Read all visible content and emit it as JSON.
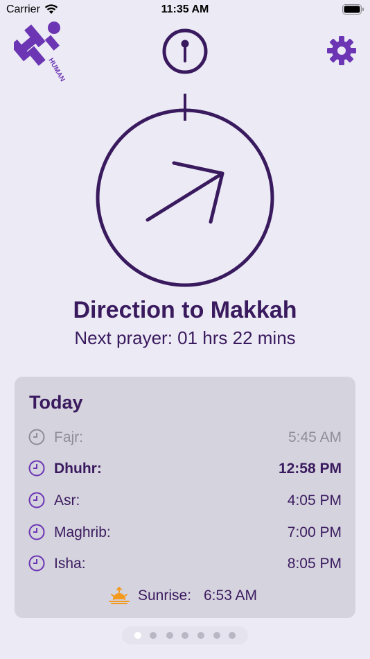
{
  "status_bar": {
    "carrier": "Carrier",
    "time": "11:35 AM"
  },
  "header": {
    "logo_text": "HUMAN APPEAL",
    "info_icon": "info-pin-icon",
    "settings_icon": "gear-icon"
  },
  "compass": {
    "title": "Direction to Makkah",
    "next_prayer": "Next prayer: 01 hrs 22 mins"
  },
  "today": {
    "title": "Today",
    "prayers": [
      {
        "name": "Fajr:",
        "time": "5:45 AM",
        "state": "past"
      },
      {
        "name": "Dhuhr:",
        "time": "12:58 PM",
        "state": "current"
      },
      {
        "name": "Asr:",
        "time": "4:05 PM",
        "state": "upcoming"
      },
      {
        "name": "Maghrib:",
        "time": "7:00 PM",
        "state": "upcoming"
      },
      {
        "name": "Isha:",
        "time": "8:05 PM",
        "state": "upcoming"
      }
    ],
    "sunrise": {
      "label": "Sunrise:",
      "time": "6:53 AM",
      "icon": "sunrise-icon"
    }
  },
  "pager": {
    "pages": 7,
    "active": 1
  },
  "colors": {
    "primary": "#3a1a5e",
    "accent": "#6b35b3",
    "background": "#ecebf5",
    "card": "#d5d3de",
    "muted": "#8f8d97",
    "sunrise": "#f39a1e"
  }
}
